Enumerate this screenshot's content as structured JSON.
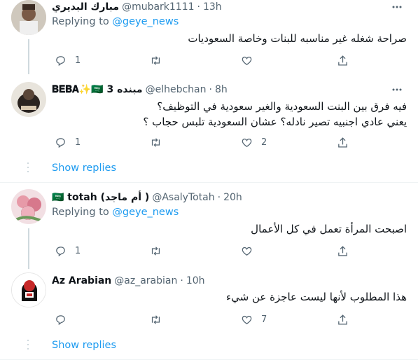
{
  "colors": {
    "accent": "#1d9bf0",
    "secondary_text": "#536471",
    "line": "#cfd9de"
  },
  "tweets": [
    {
      "name": "مبارك البديري",
      "handle": "@mubark1111",
      "time": "13h",
      "replying_prefix": "Replying to",
      "replying_handle": "@geye_news",
      "text": "صراحة شغله غير مناسبه للبنات وخاصة السعوديات",
      "reply_count": "1",
      "like_count": ""
    },
    {
      "name": "𝐁𝐄𝐁𝐀✨🇸🇦 مبنده 3",
      "handle": "@elhebchan",
      "time": "8h",
      "text_lines": [
        "فيه فرق بين البنت السعودية والغير سعودية في التوظيف؟",
        "يعني عادي اجنبيه تصير نادله؟ عشان السعودية تلبس حجاب ؟"
      ],
      "reply_count": "1",
      "like_count": "2",
      "show_replies": "Show replies"
    },
    {
      "name": "🇸🇦 totah (أم ماجد )",
      "handle": "@AsalyTotah",
      "time": "20h",
      "replying_prefix": "Replying to",
      "replying_handle": "@geye_news",
      "text": "اصبحت المرأة تعمل في كل الأعمال",
      "reply_count": "1",
      "like_count": ""
    },
    {
      "name": "Az Arabian",
      "handle": "@az_arabian",
      "time": "10h",
      "text": "هذا المطلوب لأنها ليست عاجزة عن شيء",
      "reply_count": "",
      "like_count": "7",
      "show_replies": "Show replies"
    }
  ],
  "separator": "·"
}
